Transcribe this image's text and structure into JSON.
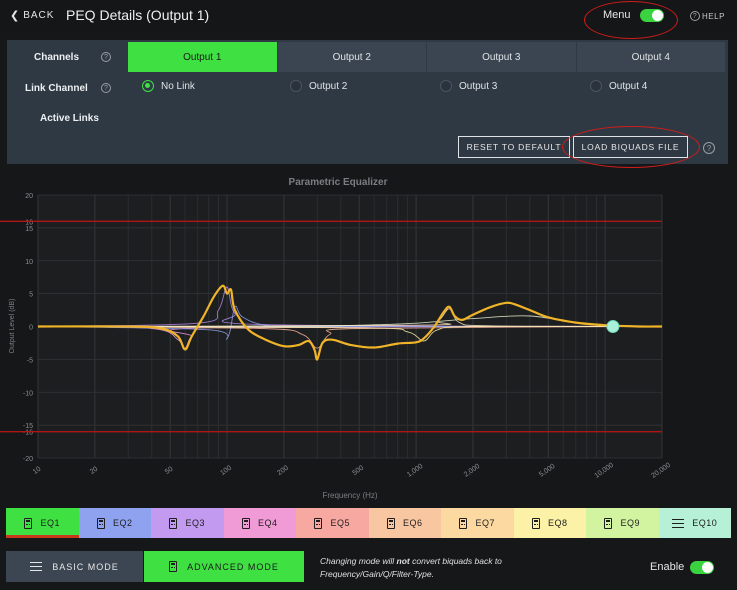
{
  "header": {
    "back_label": "BACK",
    "title": "PEQ Details (Output 1)",
    "menu_label": "Menu",
    "menu_toggle_on": true,
    "help_label": "HELP"
  },
  "channels": {
    "label": "Channels",
    "tabs": [
      "Output 1",
      "Output 2",
      "Output 3",
      "Output 4"
    ],
    "active_index": 0
  },
  "link_channel": {
    "label": "Link Channel",
    "options": [
      "No Link",
      "Output 2",
      "Output 3",
      "Output 4"
    ],
    "selected_index": 0
  },
  "active_links": {
    "label": "Active Links"
  },
  "actions": {
    "reset_label": "RESET TO DEFAULT",
    "load_label": "LOAD BIQUADS FILE"
  },
  "chart_data": {
    "type": "line",
    "title": "Parametric Equalizer",
    "xlabel": "Frequency (Hz)",
    "ylabel": "Output Level (dB)",
    "x_scale": "log",
    "xlim": [
      10,
      20000
    ],
    "ylim": [
      -20,
      20
    ],
    "x_ticks": [
      "10",
      "20",
      "50",
      "100",
      "200",
      "500",
      "1,000",
      "2,000",
      "5,000",
      "10,000",
      "20,000"
    ],
    "y_ticks": [
      "20",
      "16",
      "15",
      "10",
      "5",
      "0",
      "-5",
      "-10",
      "-15",
      "-16",
      "-20"
    ],
    "limit_lines": [
      16,
      -16
    ],
    "series": [
      {
        "name": "",
        "color": "#f0b429",
        "x": [
          10,
          30,
          45,
          55,
          60,
          65,
          75,
          85,
          95,
          100,
          105,
          110,
          130,
          160,
          200,
          240,
          270,
          290,
          300,
          320,
          360,
          450,
          600,
          800,
          1000,
          1100,
          1250,
          1400,
          1500,
          1600,
          1750,
          2000,
          2500,
          3000,
          3300,
          4000,
          5000,
          7000,
          10000,
          15000,
          20000
        ],
        "y": [
          0,
          0,
          -0.3,
          -1.5,
          -3.5,
          -1.5,
          1.5,
          4.5,
          6.2,
          5.0,
          5.6,
          2.5,
          -0.5,
          -2.0,
          -3.0,
          -2.8,
          -2.2,
          -3.5,
          -5.0,
          -2.5,
          -2.0,
          -2.8,
          -3.2,
          -2.6,
          -2.4,
          -1.8,
          0.0,
          2.2,
          3.0,
          1.6,
          1.0,
          1.8,
          3.0,
          3.6,
          3.4,
          2.5,
          1.4,
          0.6,
          0.2,
          0.0,
          0.0
        ]
      }
    ],
    "band_curves": [
      {
        "color": "#b58cf0",
        "x": [
          10,
          70,
          90,
          100,
          110,
          150,
          20000
        ],
        "y": [
          0,
          0.5,
          2.5,
          6.0,
          2.0,
          0.3,
          0
        ]
      },
      {
        "color": "#f09ae0",
        "x": [
          10,
          40,
          55,
          60,
          65,
          80,
          20000
        ],
        "y": [
          0,
          -0.3,
          -2.0,
          -3.3,
          -1.5,
          -0.2,
          0
        ]
      },
      {
        "color": "#8ea2f0",
        "x": [
          10,
          80,
          100,
          110,
          120,
          160,
          300,
          20000
        ],
        "y": [
          0,
          -0.5,
          -1.8,
          3.0,
          1.5,
          0.2,
          0,
          0
        ]
      },
      {
        "color": "#f7b09a",
        "x": [
          10,
          150,
          250,
          300,
          350,
          500,
          20000
        ],
        "y": [
          0,
          -0.3,
          -1.2,
          -3.3,
          -1.2,
          -0.3,
          0
        ]
      },
      {
        "color": "#fff2a8",
        "x": [
          10,
          500,
          900,
          1100,
          1300,
          2000,
          20000
        ],
        "y": [
          0,
          -0.2,
          -0.8,
          -2.2,
          -0.5,
          0,
          0
        ]
      },
      {
        "color": "#fce6b8",
        "x": [
          10,
          1000,
          1300,
          1500,
          1700,
          2500,
          20000
        ],
        "y": [
          0,
          0.2,
          0.8,
          2.7,
          0.6,
          0.1,
          0
        ]
      },
      {
        "color": "#e8eed0",
        "x": [
          10,
          200,
          500,
          1000,
          2000,
          4000,
          8000,
          20000
        ],
        "y": [
          0,
          0,
          0.2,
          0.5,
          1.2,
          1.6,
          0.4,
          0
        ]
      }
    ],
    "handle_point": {
      "x": 11000,
      "y": 0
    }
  },
  "eq_tabs": [
    {
      "label": "EQ1",
      "color": "#3ee042",
      "icon": "calculator-icon",
      "active": true
    },
    {
      "label": "EQ2",
      "color": "#8ea2f0",
      "icon": "calculator-icon",
      "active": false
    },
    {
      "label": "EQ3",
      "color": "#c29af0",
      "icon": "calculator-icon",
      "active": false
    },
    {
      "label": "EQ4",
      "color": "#f09ad6",
      "icon": "calculator-icon",
      "active": false
    },
    {
      "label": "EQ5",
      "color": "#f7a8a0",
      "icon": "calculator-icon",
      "active": false
    },
    {
      "label": "EQ6",
      "color": "#f9c6a2",
      "icon": "calculator-icon",
      "active": false
    },
    {
      "label": "EQ7",
      "color": "#fcd9a0",
      "icon": "calculator-icon",
      "active": false
    },
    {
      "label": "EQ8",
      "color": "#fbf2a8",
      "icon": "calculator-icon",
      "active": false
    },
    {
      "label": "EQ9",
      "color": "#d2f3a0",
      "icon": "calculator-icon",
      "active": false
    },
    {
      "label": "EQ10",
      "color": "#b6f0d6",
      "icon": "sliders-icon",
      "active": false
    }
  ],
  "modes": {
    "basic_label": "BASIC MODE",
    "advanced_label": "ADVANCED MODE",
    "note_prefix": "Changing mode will ",
    "note_bold": "not",
    "note_suffix": " convert biquads back to Frequency/Gain/Q/Filter-Type.",
    "enable_label": "Enable",
    "enable_on": true
  }
}
